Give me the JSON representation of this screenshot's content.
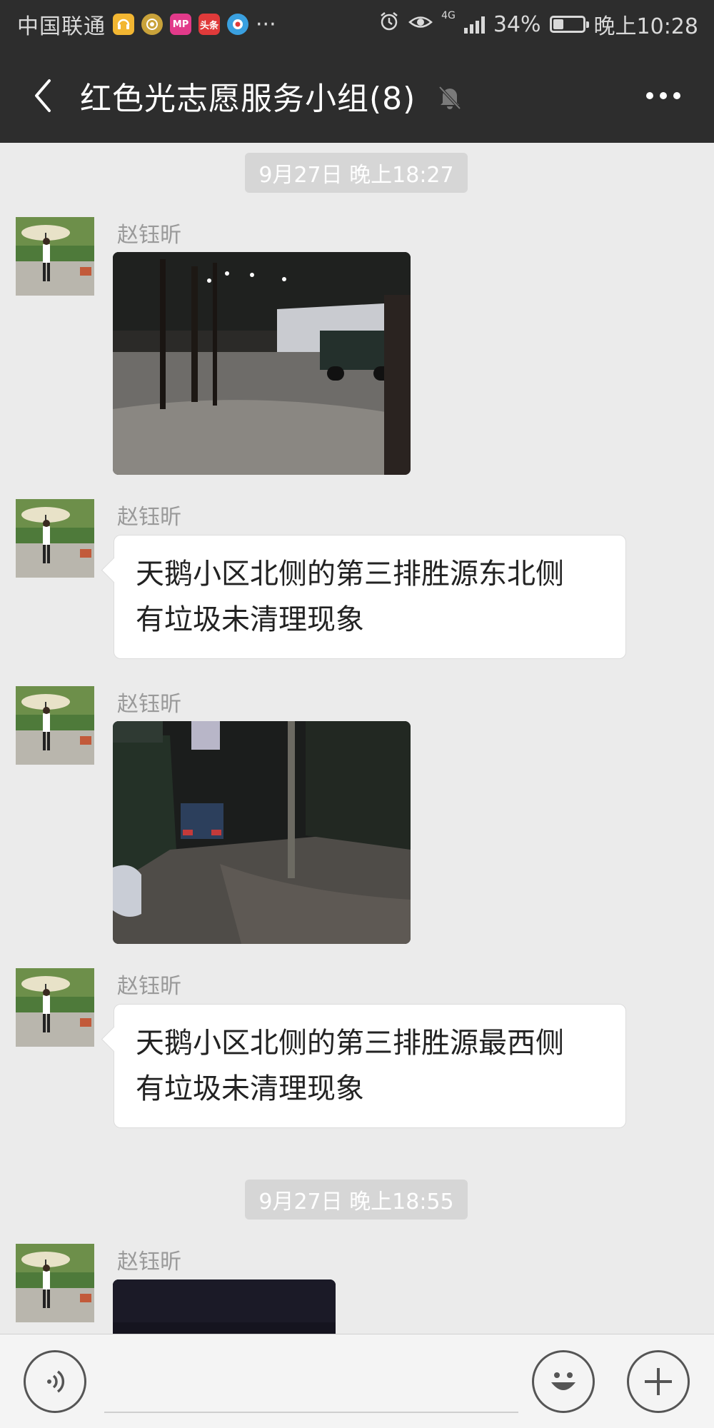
{
  "status_bar": {
    "carrier": "中国联通",
    "app_icons": [
      {
        "name": "headset-app-icon",
        "label": "",
        "color": "#f2b632"
      },
      {
        "name": "gold-coin-app-icon",
        "label": "",
        "color": "#c9a23a"
      },
      {
        "name": "mp-app-icon",
        "label": "MP",
        "color": "#e23a8a"
      },
      {
        "name": "toutiao-app-icon",
        "label": "头条",
        "color": "#e03a3a"
      },
      {
        "name": "browser-app-icon",
        "label": "",
        "color": "#3aa0e0"
      }
    ],
    "more_indicator": "···",
    "network": "4G",
    "battery_text": "34%",
    "battery_level": 0.34,
    "time": "晚上10:28"
  },
  "header": {
    "title": "红色光志愿服务小组(8)",
    "back_icon": "chevron-left-icon",
    "mute_icon": "bell-muted-icon",
    "more_icon": "more-dots-icon"
  },
  "chat": {
    "timestamps": [
      "9月27日 晚上18:27",
      "9月27日 晚上18:55"
    ],
    "messages": [
      {
        "sender": "赵钰昕",
        "type": "image",
        "photo": "night-street-truck"
      },
      {
        "sender": "赵钰昕",
        "type": "text",
        "lines": [
          "天鹅小区北侧的第三排胜源东北侧",
          "有垃圾未清理现象"
        ]
      },
      {
        "sender": "赵钰昕",
        "type": "image",
        "photo": "night-alley-car"
      },
      {
        "sender": "赵钰昕",
        "type": "text",
        "lines": [
          "天鹅小区北侧的第三排胜源最西侧",
          "有垃圾未清理现象"
        ]
      },
      {
        "sender": "赵钰昕",
        "type": "image",
        "photo": "dark-photo-partial"
      }
    ]
  },
  "input_bar": {
    "voice_icon": "voice-icon",
    "input_value": "",
    "emoji_icon": "emoji-icon",
    "plus_icon": "plus-icon"
  },
  "colors": {
    "header_bg": "#2d2d2d",
    "chat_bg": "#ebebeb",
    "timestamp_bg": "#d6d6d6",
    "bubble_bg": "#ffffff"
  }
}
